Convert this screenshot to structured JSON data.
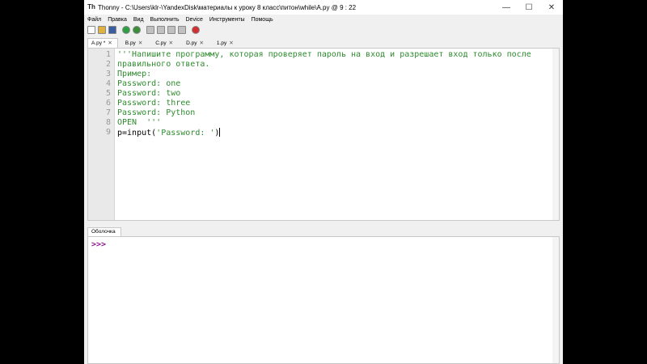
{
  "window": {
    "app_name": "Thonny",
    "path": "C:\\Users\\klr-\\YandexDisk\\материалы к уроку 8 класс\\питон\\while\\A.py",
    "separator": "@",
    "cursor_pos": "9 : 22"
  },
  "menu": [
    "Файл",
    "Правка",
    "Вид",
    "Выполнить",
    "Device",
    "Инструменты",
    "Помощь"
  ],
  "toolbar": {
    "icons": [
      {
        "name": "new-file-icon",
        "color": "#ffffff"
      },
      {
        "name": "open-file-icon",
        "color": "#e0b040"
      },
      {
        "name": "save-file-icon",
        "color": "#3a5fa0"
      },
      {
        "name": "run-icon",
        "color": "#2ea043"
      },
      {
        "name": "debug-icon",
        "color": "#3a8f3a"
      },
      {
        "name": "step-over-icon",
        "color": "#c0c0c0"
      },
      {
        "name": "step-into-icon",
        "color": "#c0c0c0"
      },
      {
        "name": "step-out-icon",
        "color": "#c0c0c0"
      },
      {
        "name": "resume-icon",
        "color": "#c0c0c0"
      },
      {
        "name": "stop-icon",
        "color": "#d03030"
      }
    ]
  },
  "tabs": [
    {
      "label": "A.py *",
      "active": true,
      "close": "✕"
    },
    {
      "label": "B.py",
      "active": false,
      "close": "✕"
    },
    {
      "label": "C.py",
      "active": false,
      "close": "✕"
    },
    {
      "label": "D.py",
      "active": false,
      "close": "✕"
    },
    {
      "label": "1.py",
      "active": false,
      "close": "✕"
    }
  ],
  "editor": {
    "line_numbers": [
      "1",
      "2",
      "3",
      "4",
      "5",
      "6",
      "7",
      "8",
      "9"
    ],
    "lines": [
      "'''Напишите программу, которая проверяет пароль на вход и разрешает вход только после",
      "правильного ответа.",
      "Пример:",
      "Password: one",
      "Password: two",
      "Password: three",
      "Password: Python",
      "OPEN  '''"
    ],
    "last_line": {
      "prefix": "p=input(",
      "string": "'Password: '",
      "suffix": ")"
    }
  },
  "shell": {
    "tab_label": "Оболочка",
    "prompt": ">>>"
  }
}
